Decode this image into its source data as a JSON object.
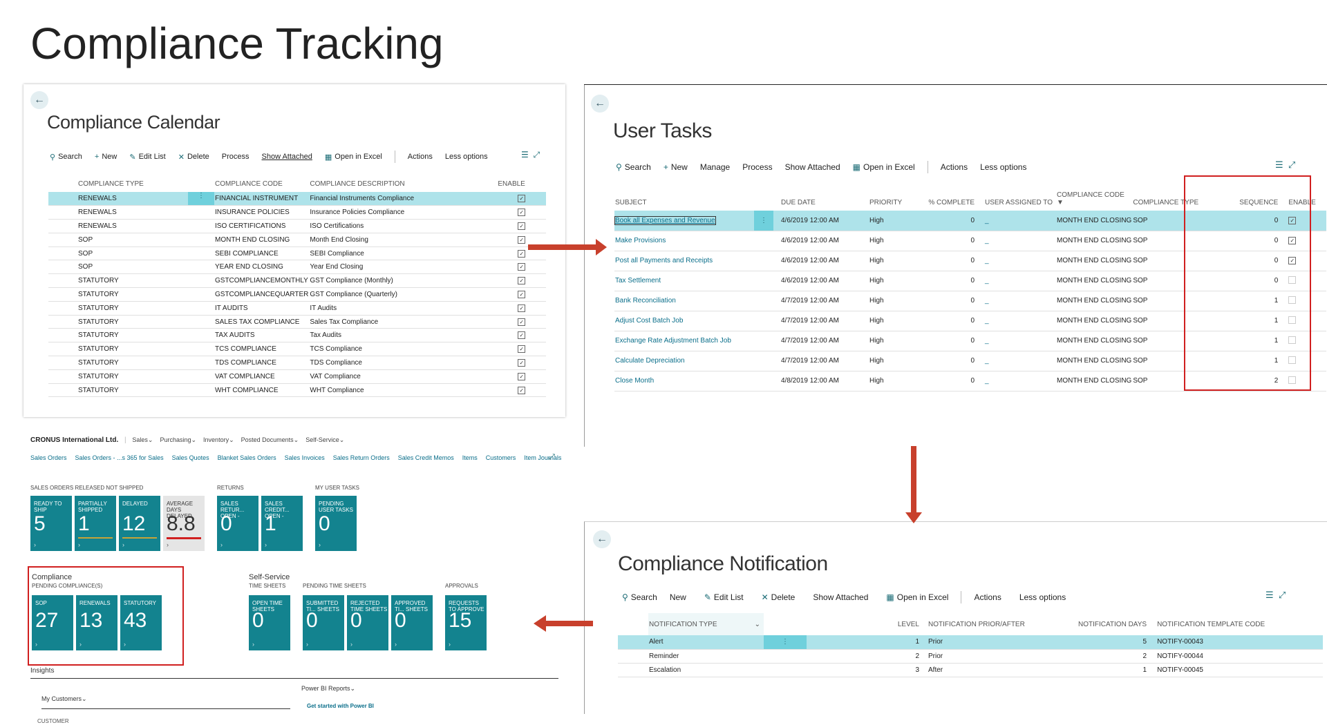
{
  "slide": {
    "title": "Compliance Tracking"
  },
  "colors": {
    "accent": "#13838f",
    "selected_row": "#aee3ea",
    "highlight_box": "#d01f1f",
    "arrow": "#c8402c"
  },
  "calendar": {
    "title": "Compliance Calendar",
    "toolbar": [
      "Search",
      "New",
      "Edit List",
      "Delete",
      "Process",
      "Show Attached",
      "Open in Excel",
      "Actions",
      "Less options"
    ],
    "columns": [
      "COMPLIANCE TYPE",
      "COMPLIANCE CODE",
      "COMPLIANCE DESCRIPTION",
      "ENABLE"
    ],
    "rows": [
      [
        "RENEWALS",
        "FINANCIAL INSTRUMENT",
        "Financial Instruments Compliance"
      ],
      [
        "RENEWALS",
        "INSURANCE POLICIES",
        "Insurance Policies Compliance"
      ],
      [
        "RENEWALS",
        "ISO CERTIFICATIONS",
        "ISO Certifications"
      ],
      [
        "SOP",
        "MONTH END CLOSING",
        "Month End Closing"
      ],
      [
        "SOP",
        "SEBI COMPLIANCE",
        "SEBI Compliance"
      ],
      [
        "SOP",
        "YEAR END CLOSING",
        "Year End Closing"
      ],
      [
        "STATUTORY",
        "GSTCOMPLIANCEMONTHLY",
        "GST Compliance (Monthly)"
      ],
      [
        "STATUTORY",
        "GSTCOMPLIANCEQUARTER",
        "GST Compliance (Quarterly)"
      ],
      [
        "STATUTORY",
        "IT AUDITS",
        "IT Audits"
      ],
      [
        "STATUTORY",
        "SALES TAX COMPLIANCE",
        "Sales Tax Compliance"
      ],
      [
        "STATUTORY",
        "TAX AUDITS",
        "Tax Audits"
      ],
      [
        "STATUTORY",
        "TCS COMPLIANCE",
        "TCS Compliance"
      ],
      [
        "STATUTORY",
        "TDS COMPLIANCE",
        "TDS Compliance"
      ],
      [
        "STATUTORY",
        "VAT COMPLIANCE",
        "VAT Compliance"
      ],
      [
        "STATUTORY",
        "WHT COMPLIANCE",
        "WHT Compliance"
      ]
    ]
  },
  "tasks": {
    "title": "User Tasks",
    "toolbar": [
      "Search",
      "New",
      "Manage",
      "Process",
      "Show Attached",
      "Open in Excel",
      "Actions",
      "Less options"
    ],
    "columns": [
      "SUBJECT",
      "DUE DATE",
      "PRIORITY",
      "% COMPLETE",
      "USER ASSIGNED TO",
      "COMPLIANCE CODE",
      "COMPLIANCE TYPE",
      "SEQUENCE",
      "ENABLE"
    ],
    "rows": [
      {
        "subject": "Book all Expenses and Revenue",
        "due": "4/6/2019 12:00 AM",
        "priority": "High",
        "pct": "0",
        "user": "_",
        "code": "MONTH END CLOSING",
        "type": "SOP",
        "seq": "0",
        "enable": true
      },
      {
        "subject": "Make Provisions",
        "due": "4/6/2019 12:00 AM",
        "priority": "High",
        "pct": "0",
        "user": "_",
        "code": "MONTH END CLOSING",
        "type": "SOP",
        "seq": "0",
        "enable": true
      },
      {
        "subject": "Post all Payments and Receipts",
        "due": "4/6/2019 12:00 AM",
        "priority": "High",
        "pct": "0",
        "user": "_",
        "code": "MONTH END CLOSING",
        "type": "SOP",
        "seq": "0",
        "enable": true
      },
      {
        "subject": "Tax Settlement",
        "due": "4/6/2019 12:00 AM",
        "priority": "High",
        "pct": "0",
        "user": "_",
        "code": "MONTH END CLOSING",
        "type": "SOP",
        "seq": "0",
        "enable": false
      },
      {
        "subject": "Bank Reconciliation",
        "due": "4/7/2019 12:00 AM",
        "priority": "High",
        "pct": "0",
        "user": "_",
        "code": "MONTH END CLOSING",
        "type": "SOP",
        "seq": "1",
        "enable": false
      },
      {
        "subject": "Adjust Cost Batch Job",
        "due": "4/7/2019 12:00 AM",
        "priority": "High",
        "pct": "0",
        "user": "_",
        "code": "MONTH END CLOSING",
        "type": "SOP",
        "seq": "1",
        "enable": false
      },
      {
        "subject": "Exchange Rate Adjustment Batch Job",
        "due": "4/7/2019 12:00 AM",
        "priority": "High",
        "pct": "0",
        "user": "_",
        "code": "MONTH END CLOSING",
        "type": "SOP",
        "seq": "1",
        "enable": false
      },
      {
        "subject": "Calculate Depreciation",
        "due": "4/7/2019 12:00 AM",
        "priority": "High",
        "pct": "0",
        "user": "_",
        "code": "MONTH END CLOSING",
        "type": "SOP",
        "seq": "1",
        "enable": false
      },
      {
        "subject": "Close Month",
        "due": "4/8/2019 12:00 AM",
        "priority": "High",
        "pct": "0",
        "user": "_",
        "code": "MONTH END CLOSING",
        "type": "SOP",
        "seq": "2",
        "enable": false
      }
    ]
  },
  "rolecenter": {
    "company": "CRONUS International Ltd.",
    "menus": [
      "Sales",
      "Purchasing",
      "Inventory",
      "Posted Documents",
      "Self-Service"
    ],
    "links": [
      "Sales Orders",
      "Sales Orders - ...s 365 for Sales",
      "Sales Quotes",
      "Blanket Sales Orders",
      "Sales Invoices",
      "Sales Return Orders",
      "Sales Credit Memos",
      "Items",
      "Customers",
      "Item Journals",
      "More"
    ],
    "groups": {
      "released": "SALES ORDERS RELEASED NOT SHIPPED",
      "returns": "RETURNS",
      "mytasks": "MY USER TASKS",
      "compliance_title": "Compliance",
      "pending": "PENDING COMPLIANCE(S)",
      "selfservice_title": "Self-Service",
      "timesheets": "TIME SHEETS",
      "pending_ts": "PENDING TIME SHEETS",
      "approvals": "APPROVALS"
    },
    "tiles": {
      "ready": {
        "label": "READY TO SHIP",
        "value": "5"
      },
      "partial": {
        "label": "PARTIALLY SHIPPED",
        "value": "1"
      },
      "delayed": {
        "label": "DELAYED",
        "value": "12"
      },
      "avgdays": {
        "label": "AVERAGE DAYS DELAYED",
        "value": "8.8"
      },
      "salesret": {
        "label": "SALES RETUR... OPEN -",
        "value": "0"
      },
      "salescred": {
        "label": "SALES CREDIT... OPEN -",
        "value": "1"
      },
      "pendtasks": {
        "label": "PENDING USER TASKS",
        "value": "0"
      },
      "sop": {
        "label": "SOP",
        "value": "27"
      },
      "renewals": {
        "label": "RENEWALS",
        "value": "13"
      },
      "statutory": {
        "label": "STATUTORY",
        "value": "43"
      },
      "opents": {
        "label": "OPEN TIME SHEETS",
        "value": "0"
      },
      "submitted": {
        "label": "SUBMITTED TI... SHEETS",
        "value": "0"
      },
      "rejected": {
        "label": "REJECTED TIME SHEETS",
        "value": "0"
      },
      "approved": {
        "label": "APPROVED TI... SHEETS",
        "value": "0"
      },
      "requests": {
        "label": "REQUESTS TO APPROVE",
        "value": "15"
      }
    },
    "insights": "Insights",
    "mycustomers": "My Customers",
    "customer_col": "CUSTOMER",
    "powerbi": "Power BI Reports",
    "getstarted": "Get started with Power BI"
  },
  "notification": {
    "title": "Compliance Notification",
    "toolbar": [
      "Search",
      "New",
      "Edit List",
      "Delete",
      "Show Attached",
      "Open in Excel",
      "Actions",
      "Less options"
    ],
    "columns": [
      "NOTIFICATION TYPE",
      "LEVEL",
      "NOTIFICATION PRIOR/AFTER",
      "NOTIFICATION DAYS",
      "NOTIFICATION TEMPLATE CODE"
    ],
    "rows": [
      [
        "Alert",
        "1",
        "Prior",
        "5",
        "NOTIFY-00043"
      ],
      [
        "Reminder",
        "2",
        "Prior",
        "2",
        "NOTIFY-00044"
      ],
      [
        "Escalation",
        "3",
        "After",
        "1",
        "NOTIFY-00045"
      ]
    ]
  }
}
